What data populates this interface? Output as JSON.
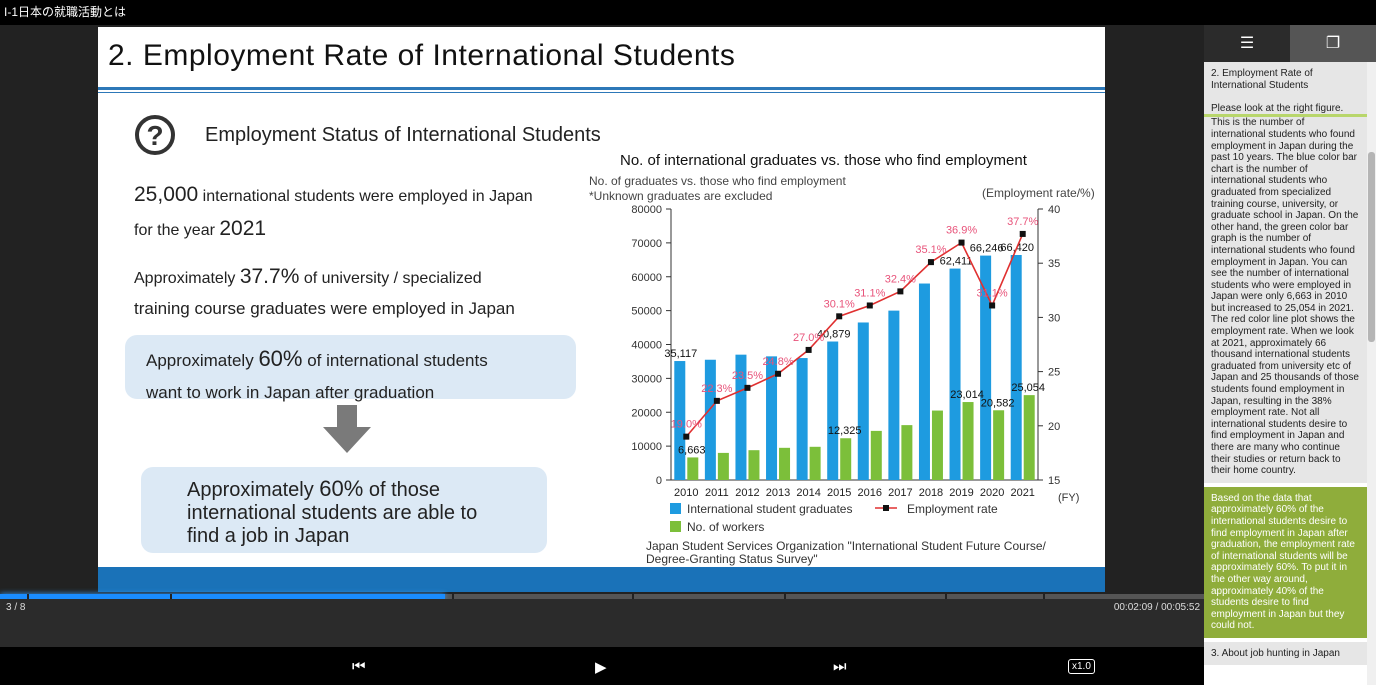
{
  "window_title": "I-1日本の就職活動とは",
  "slide": {
    "title": "2.  Employment Rate of International Students",
    "subtitle": "Employment Status of International Students",
    "line1_num": "25,000",
    "line1_text": " international students were employed in Japan",
    "line2_pre": "for the year ",
    "line2_num": "2021",
    "line3_pre": "Approximately ",
    "line3_num": "37.7%",
    "line3_post": " of university / specialized",
    "line4": "training course graduates were employed in Japan",
    "box1_pre": "Approximately ",
    "box1_num": "60%",
    "box1_post": " of international students",
    "box1_line2": "want to work in Japan after graduation",
    "box2_pre": "Approximately ",
    "box2_num": "60%",
    "box2_post": " of those",
    "box2_line2": "international students are able to",
    "box2_line3": "find a job in Japan",
    "chart_title": "No. of international graduates vs. those who find employment",
    "chart_sub1": "No. of graduates vs. those who find employment",
    "chart_sub2": "*Unknown graduates are excluded",
    "rate_axis_label": "(Employment rate/%)",
    "fy_label": "(FY)",
    "source_line1": "Japan Student Services Organization   \"International Student Future Course/",
    "source_line2": "Degree-Granting Status Survey\""
  },
  "chart_data": {
    "type": "bar",
    "categories": [
      "2010",
      "2011",
      "2012",
      "2013",
      "2014",
      "2015",
      "2016",
      "2017",
      "2018",
      "2019",
      "2020",
      "2021"
    ],
    "series": [
      {
        "name": "International student graduates",
        "kind": "bar",
        "axis": "left",
        "color": "#1e9be0",
        "values": [
          35117,
          35500,
          37000,
          36500,
          36000,
          40879,
          46500,
          50000,
          58000,
          62411,
          66246,
          66420
        ]
      },
      {
        "name": "No. of workers",
        "kind": "bar",
        "axis": "left",
        "color": "#7cbf3a",
        "values": [
          6663,
          8000,
          8800,
          9500,
          9800,
          12325,
          14500,
          16200,
          20500,
          23014,
          20582,
          25054
        ]
      },
      {
        "name": "Employment rate",
        "kind": "line",
        "axis": "right",
        "color": "#e03030",
        "values": [
          19.0,
          22.3,
          23.5,
          24.8,
          27.0,
          30.1,
          31.1,
          32.4,
          35.1,
          36.9,
          31.1,
          37.7
        ]
      }
    ],
    "bar_labels": [
      {
        "series": 0,
        "index": 0,
        "text": "35,117"
      },
      {
        "series": 0,
        "index": 5,
        "text": "40,879"
      },
      {
        "series": 0,
        "index": 9,
        "text": "62,411"
      },
      {
        "series": 0,
        "index": 10,
        "text": "66,246"
      },
      {
        "series": 0,
        "index": 11,
        "text": "66,420"
      },
      {
        "series": 1,
        "index": 0,
        "text": "6,663"
      },
      {
        "series": 1,
        "index": 5,
        "text": "12,325"
      },
      {
        "series": 1,
        "index": 9,
        "text": "23,014"
      },
      {
        "series": 1,
        "index": 10,
        "text": "20,582"
      },
      {
        "series": 1,
        "index": 11,
        "text": "25,054"
      }
    ],
    "rate_labels": [
      "19.0%",
      "22.3%",
      "23.5%",
      "24.8%",
      "27.0%",
      "30.1%",
      "31.1%",
      "32.4%",
      "35.1%",
      "36.9%",
      "31.1%",
      "37.7%"
    ],
    "y_left": {
      "min": 0,
      "max": 80000,
      "ticks": [
        "0",
        "10000",
        "20000",
        "30000",
        "40000",
        "50000",
        "60000",
        "70000",
        "80000"
      ]
    },
    "y_right": {
      "min": 15,
      "max": 40,
      "ticks": [
        "15",
        "20",
        "25",
        "30",
        "35",
        "40"
      ]
    },
    "legend_position": "bottom"
  },
  "player": {
    "page": "3 / 8",
    "time": "00:02:09 / 00:05:52",
    "progress": 0.37,
    "speed": "x1.0"
  },
  "sidebar": {
    "note1_title": "2. Employment Rate of International Students",
    "note1_body_a": "Please look at the right figure.",
    "note1_body_b": "This is the number of international students who found employment in Japan during the past 10 years. The blue color bar chart is the number of international students who graduated from specialized training course, university, or graduate school in Japan. On the other hand, the green color bar graph is the number of international students who found employment in Japan. You can see the number of international students who were employed in Japan were only 6,663 in 2010 but increased to 25,054 in 2021. The red color line plot shows the employment rate. When we look at 2021, approximately 66 thousand international students graduated from university etc of Japan and 25 thousands of those students found employment in Japan, resulting in the 38% employment rate. Not all international students desire to find employment in Japan and there are many who continue their studies or return back to their home country.",
    "note2": "Based on the data that approximately 60% of the international students desire to find employment in Japan after graduation, the employment rate of international students will be approximately 60%.    To put it in the other way around, approximately 40% of the students desire to find employment in Japan but they could not.",
    "note3": "3. About job hunting in Japan"
  }
}
